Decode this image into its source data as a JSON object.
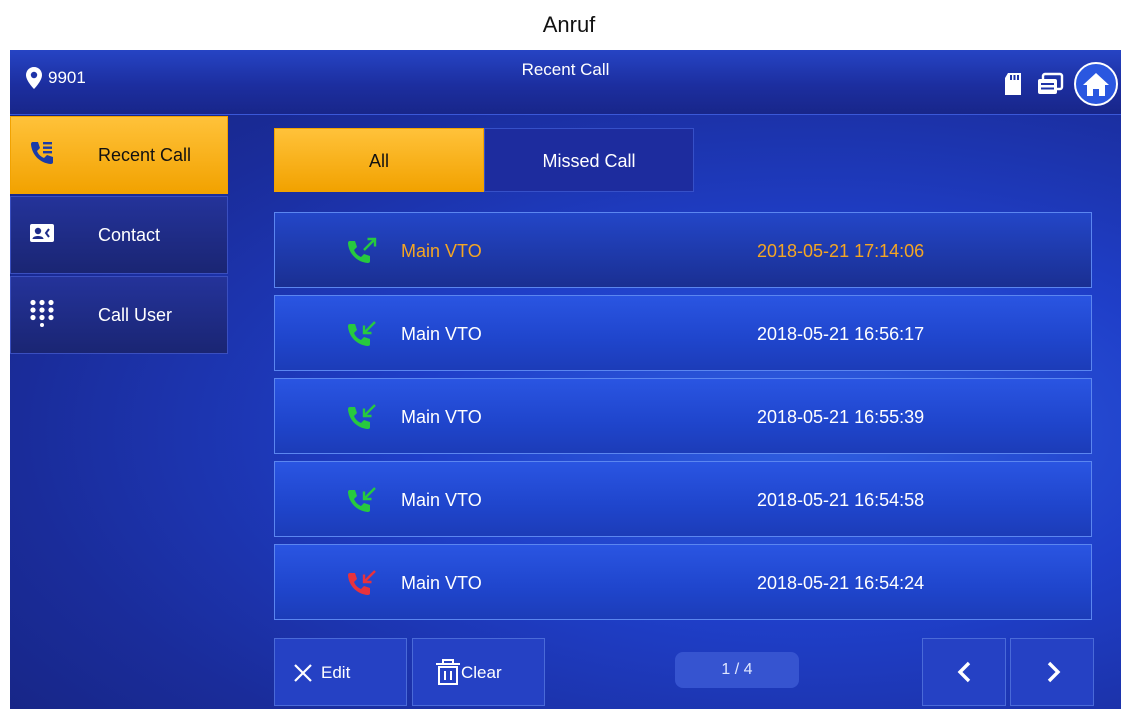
{
  "caption": "Anruf",
  "topbar": {
    "location_icon": "location-pin-icon",
    "room_number": "9901",
    "title": "Recent Call",
    "status_icons": [
      "sd-card-icon",
      "message-icon",
      "home-icon"
    ]
  },
  "sidebar": {
    "items": [
      {
        "label": "Recent Call",
        "icon": "recent-call-icon",
        "active": true
      },
      {
        "label": "Contact",
        "icon": "contact-card-icon",
        "active": false
      },
      {
        "label": "Call User",
        "icon": "dialpad-icon",
        "active": false
      }
    ]
  },
  "tabs": [
    {
      "label": "All",
      "active": true
    },
    {
      "label": "Missed Call",
      "active": false
    }
  ],
  "calls": [
    {
      "name": "Main VTO",
      "time": "2018-05-21 17:14:06",
      "type": "outgoing",
      "icon": "outgoing-call-icon",
      "selected": true
    },
    {
      "name": "Main VTO",
      "time": "2018-05-21 16:56:17",
      "type": "incoming",
      "icon": "incoming-call-icon",
      "selected": false
    },
    {
      "name": "Main VTO",
      "time": "2018-05-21 16:55:39",
      "type": "incoming",
      "icon": "incoming-call-icon",
      "selected": false
    },
    {
      "name": "Main VTO",
      "time": "2018-05-21 16:54:58",
      "type": "incoming",
      "icon": "incoming-call-icon",
      "selected": false
    },
    {
      "name": "Main VTO",
      "time": "2018-05-21 16:54:24",
      "type": "missed",
      "icon": "missed-call-icon",
      "selected": false
    }
  ],
  "footer": {
    "edit_label": "Edit",
    "clear_label": "Clear",
    "page_indicator": "1 / 4",
    "prev_icon": "chevron-left-icon",
    "next_icon": "chevron-right-icon"
  },
  "colors": {
    "accent": "#f2a200",
    "selected_text": "#f5a623",
    "call_green": "#27c93f",
    "call_missed": "#e8323c",
    "background": "#1f3fc9"
  }
}
